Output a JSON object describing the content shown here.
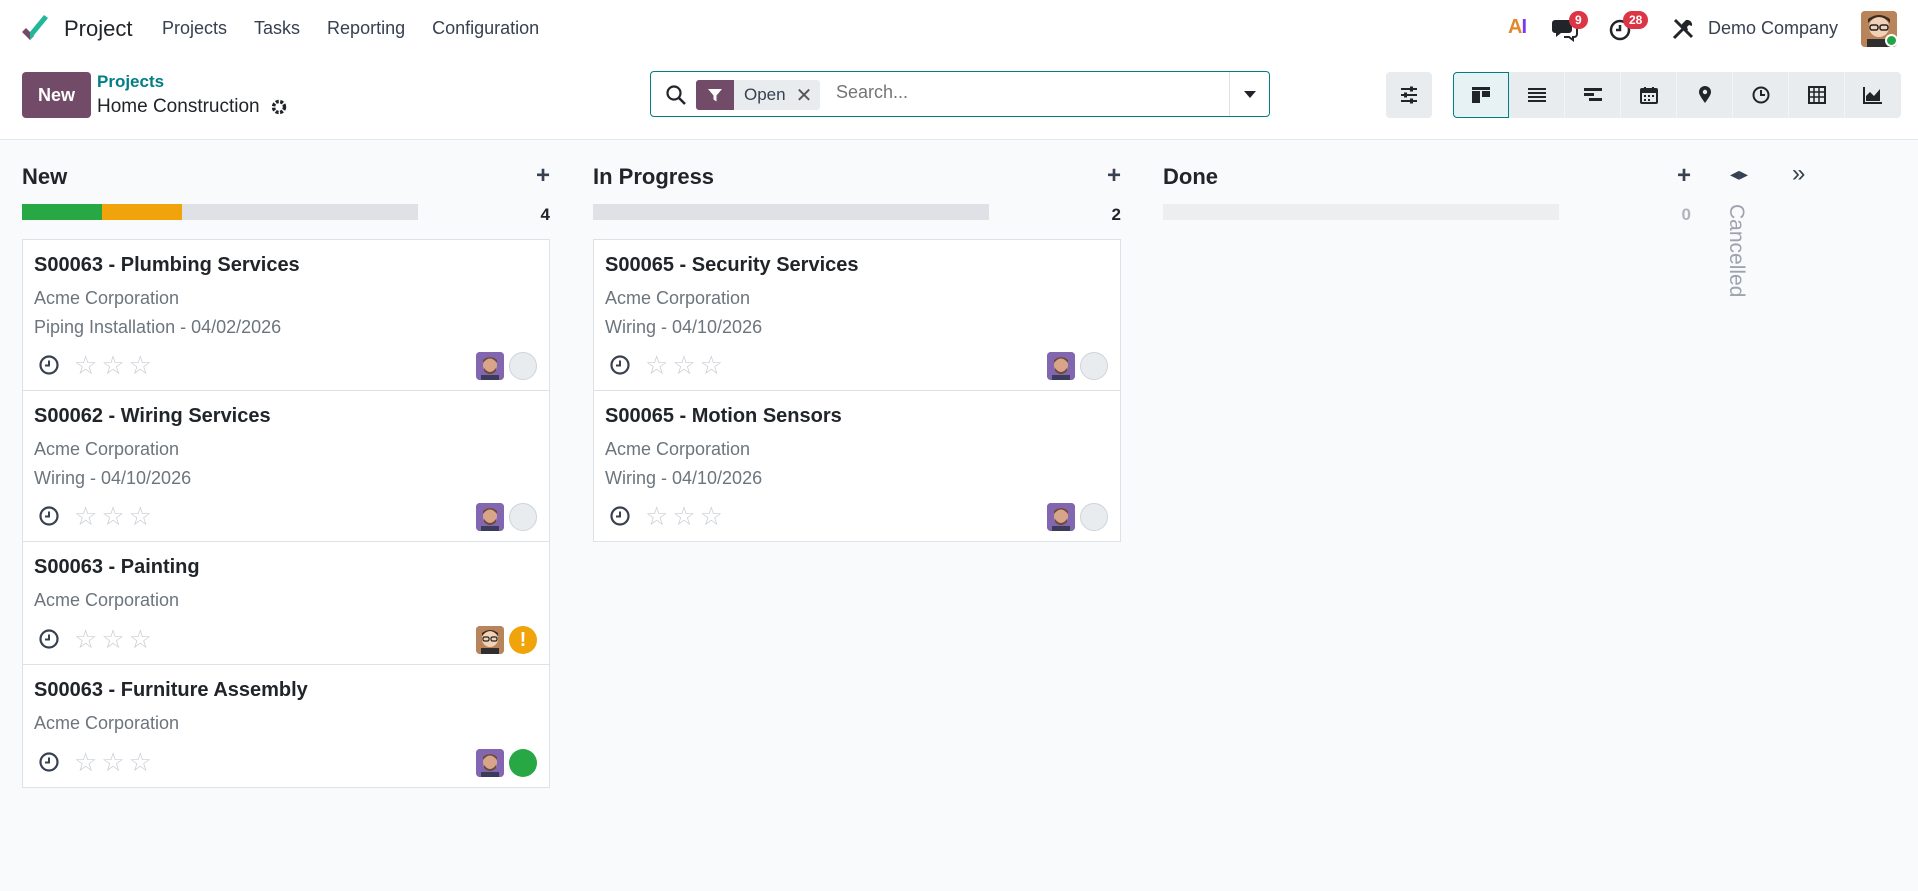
{
  "app": {
    "name": "Project"
  },
  "menu": [
    "Projects",
    "Tasks",
    "Reporting",
    "Configuration"
  ],
  "systray": {
    "ai_label_a": "A",
    "ai_label_i": "I",
    "messages_count": "9",
    "activities_count": "28",
    "company": "Demo Company"
  },
  "control": {
    "new_label": "New",
    "breadcrumb_parent": "Projects",
    "breadcrumb_current": "Home Construction"
  },
  "search": {
    "facet": "Open",
    "placeholder": "Search..."
  },
  "colors": {
    "primary": "#714b67",
    "accent": "#017e84",
    "green": "#28a745",
    "orange": "#f0a30a",
    "red": "#dc3545"
  },
  "columns": [
    {
      "title": "New",
      "count": "4",
      "progress": [
        {
          "color": "#28a745",
          "fraction": 0.25
        },
        {
          "color": "#f0a30a",
          "fraction": 0.25
        }
      ],
      "cards": [
        {
          "title": "S00063 - Plumbing Services",
          "customer": "Acme Corporation",
          "detail": "Piping Installation - 04/02/2026",
          "state": "normal",
          "avatar": "man"
        },
        {
          "title": "S00062 - Wiring Services",
          "customer": "Acme Corporation",
          "detail": "Wiring - 04/10/2026",
          "state": "normal",
          "avatar": "man"
        },
        {
          "title": "S00063 - Painting",
          "customer": "Acme Corporation",
          "detail": "",
          "state": "blocked",
          "blocked_glyph": "!",
          "avatar": "admin"
        },
        {
          "title": "S00063 - Furniture Assembly",
          "customer": "Acme Corporation",
          "detail": "",
          "state": "done",
          "avatar": "man"
        }
      ]
    },
    {
      "title": "In Progress",
      "count": "2",
      "progress": [],
      "cards": [
        {
          "title": "S00065 - Security Services",
          "customer": "Acme Corporation",
          "detail": "Wiring - 04/10/2026",
          "state": "normal",
          "avatar": "man"
        },
        {
          "title": "S00065 - Motion Sensors",
          "customer": "Acme Corporation",
          "detail": "Wiring - 04/10/2026",
          "state": "normal",
          "avatar": "man"
        }
      ]
    },
    {
      "title": "Done",
      "count": "0",
      "progress": [],
      "cards": []
    }
  ],
  "folded_column": {
    "title": "Cancelled"
  }
}
